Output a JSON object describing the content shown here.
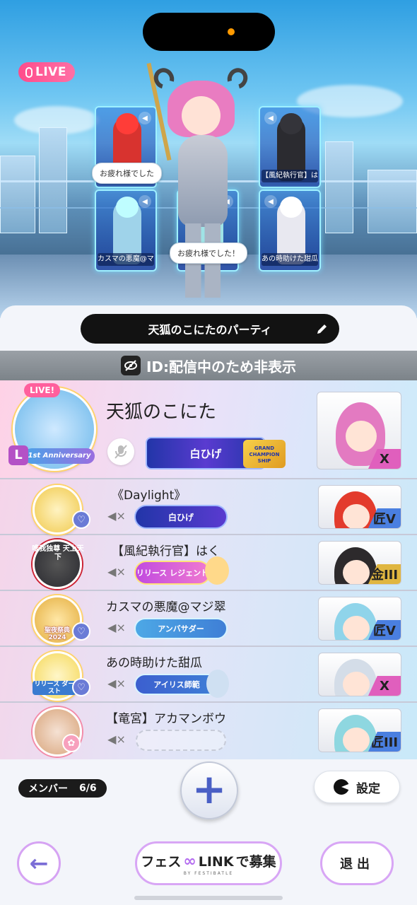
{
  "live_badge": {
    "label": "LIVE"
  },
  "stage": {
    "slots": [
      {
        "tag": "",
        "color": "#d8332f"
      },
      {
        "tag": "【風紀執行官】はく",
        "color": "#2b2b30"
      },
      {
        "tag": "カスマの悪魔@マジ翠",
        "color": "#9fd3ea"
      },
      {
        "tag": "",
        "color": "#9fe3e6"
      },
      {
        "tag": "あの時助けた甜瓜",
        "color": "#e8e8f0"
      }
    ],
    "bubbles": [
      "お疲れ様でした",
      "お疲れ様でした！"
    ]
  },
  "party": {
    "name": "天狐のこにたのパーティ",
    "id_label": "ID:配信中のため非表示"
  },
  "leader": {
    "name": "天狐のこにた",
    "level_badge": "L",
    "badge_text": "1st Anniversary",
    "badge_live": "LIVE!",
    "title": "白ひげ",
    "title_badge": "GRAND CHAMPION SHIP",
    "rank": "X"
  },
  "members": [
    {
      "name": "《Daylight》",
      "title": "白ひげ",
      "rank": "匠V",
      "hair": "#e33b2c",
      "badge_color": "#f0c94b"
    },
    {
      "name": "【風紀執行官】はく",
      "title": "リリース レジェンド",
      "rank": "金III",
      "hair": "#2d2a2c",
      "badge_color": "#3a3a42",
      "badge_text": "唯我独尊 天上天下"
    },
    {
      "name": "カスマの悪魔@マジ翠",
      "title": "アンバサダー",
      "rank": "匠V",
      "hair": "#8fd4ea",
      "badge_color": "#e4ae3f",
      "badge_text": "聖夜祭典 2024"
    },
    {
      "name": "あの時助けた甜瓜",
      "title": "アイリス師範",
      "rank": "X",
      "hair": "#d4dde8",
      "badge_color": "#f5d85a",
      "badge_text": "リリース ダースト"
    },
    {
      "name": "【竜宮】アカマンボウ",
      "title": "",
      "rank": "匠III",
      "hair": "#8ed7e0",
      "badge_color": "#d8a47a"
    }
  ],
  "footer": {
    "member_label": "メンバー",
    "member_count": "6/6",
    "settings_label": "設定",
    "recruit_label_a": "フェス",
    "recruit_label_b": "LINK",
    "recruit_label_c": "で募集",
    "recruit_sub": "BY FESTIBATLE",
    "exit_label": "退出"
  },
  "colors": {
    "accent": "#d8a6f5",
    "plus": "#4a5fc5",
    "live": "#ff4c8b"
  }
}
